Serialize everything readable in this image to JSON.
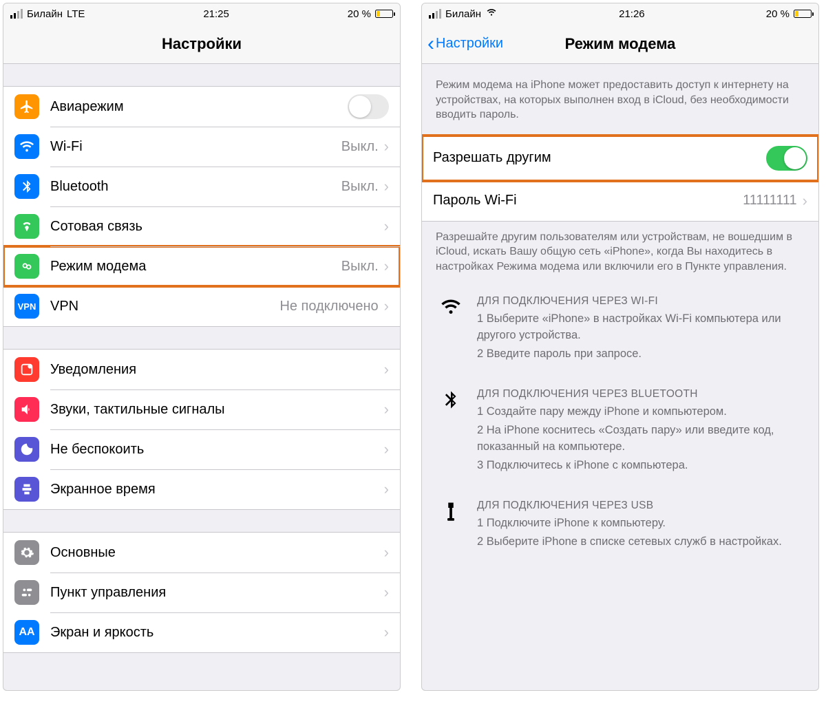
{
  "left": {
    "status": {
      "carrier": "Билайн",
      "net": "LTE",
      "time": "21:25",
      "battery": "20 %"
    },
    "nav": {
      "title": "Настройки"
    },
    "g1": [
      {
        "name": "airplane",
        "label": "Авиарежим",
        "type": "switch",
        "on": false,
        "color": "#ff9500"
      },
      {
        "name": "wifi",
        "label": "Wi-Fi",
        "detail": "Выкл.",
        "color": "#007aff"
      },
      {
        "name": "bluetooth",
        "label": "Bluetooth",
        "detail": "Выкл.",
        "color": "#007aff"
      },
      {
        "name": "cellular",
        "label": "Сотовая связь",
        "color": "#34c759"
      },
      {
        "name": "hotspot",
        "label": "Режим модема",
        "detail": "Выкл.",
        "color": "#34c759",
        "highlight": true
      },
      {
        "name": "vpn",
        "label": "VPN",
        "detail": "Не подключено",
        "color": "#007aff",
        "vpntext": "VPN"
      }
    ],
    "g2": [
      {
        "name": "notifications",
        "label": "Уведомления",
        "color": "#ff3b30"
      },
      {
        "name": "sounds",
        "label": "Звуки, тактильные сигналы",
        "color": "#ff2d55"
      },
      {
        "name": "dnd",
        "label": "Не беспокоить",
        "color": "#5856d6"
      },
      {
        "name": "screentime",
        "label": "Экранное время",
        "color": "#5856d6"
      }
    ],
    "g3": [
      {
        "name": "general",
        "label": "Основные",
        "color": "#8e8e93"
      },
      {
        "name": "controlcenter",
        "label": "Пункт управления",
        "color": "#8e8e93"
      },
      {
        "name": "display",
        "label": "Экран и яркость",
        "color": "#007aff",
        "aatext": "AA"
      }
    ]
  },
  "right": {
    "status": {
      "carrier": "Билайн",
      "time": "21:26",
      "battery": "20 %"
    },
    "nav": {
      "back": "Настройки",
      "title": "Режим модема"
    },
    "desc1": "Режим модема на iPhone может предоставить доступ к интернету на устройствах, на которых выполнен вход в iCloud, без необходимости вводить пароль.",
    "rows": {
      "allow": {
        "label": "Разрешать другим",
        "on": true,
        "highlight": true
      },
      "password": {
        "label": "Пароль Wi-Fi",
        "value": "11111111"
      }
    },
    "desc2": "Разрешайте другим пользователям или устройствам, не вошедшим в iCloud, искать Вашу общую сеть «iPhone», когда Вы находитесь в настройках Режима модема или включили его в Пункте управления.",
    "instr": [
      {
        "name": "wifi",
        "title": "ДЛЯ ПОДКЛЮЧЕНИЯ ЧЕРЕЗ WI-FI",
        "steps": [
          "1 Выберите «iPhone» в настройках Wi-Fi компьютера или другого устройства.",
          "2 Введите пароль при запросе."
        ]
      },
      {
        "name": "bluetooth",
        "title": "ДЛЯ ПОДКЛЮЧЕНИЯ ЧЕРЕЗ BLUETOOTH",
        "steps": [
          "1 Создайте пару между iPhone и компьютером.",
          "2 На iPhone коснитесь «Создать пару» или введите код, показанный на компьютере.",
          "3 Подключитесь к iPhone с компьютера."
        ]
      },
      {
        "name": "usb",
        "title": "ДЛЯ ПОДКЛЮЧЕНИЯ ЧЕРЕЗ USB",
        "steps": [
          "1 Подключите iPhone к компьютеру.",
          "2 Выберите iPhone в списке сетевых служб в настройках."
        ]
      }
    ]
  }
}
